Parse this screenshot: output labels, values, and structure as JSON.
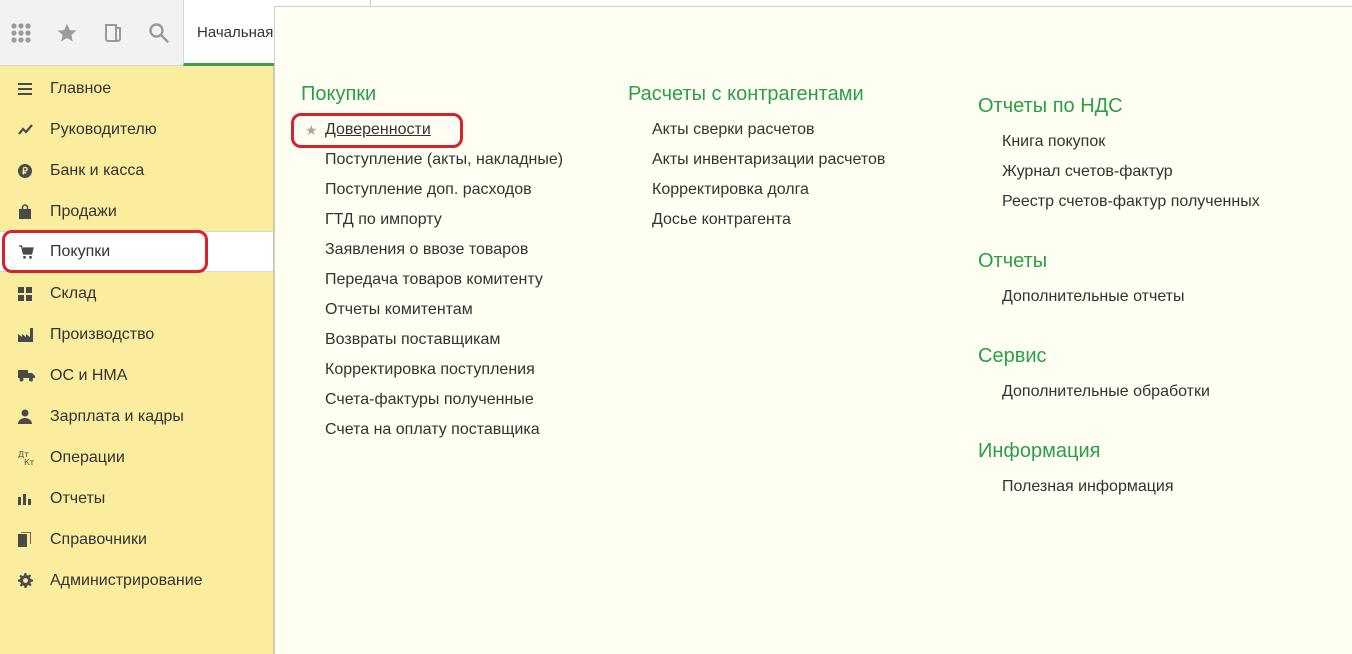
{
  "toolbar": {
    "icons": [
      "apps-grid-icon",
      "favorites-star-icon",
      "history-icon",
      "search-icon"
    ],
    "start_tab": "Начальная страница"
  },
  "sidebar": {
    "items": [
      {
        "label": "Главное",
        "icon": "menu-lines-icon"
      },
      {
        "label": "Руководителю",
        "icon": "trend-icon"
      },
      {
        "label": "Банк и касса",
        "icon": "ruble-coin-icon"
      },
      {
        "label": "Продажи",
        "icon": "shopping-bag-icon"
      },
      {
        "label": "Покупки",
        "icon": "shopping-cart-icon"
      },
      {
        "label": "Склад",
        "icon": "warehouse-grid-icon"
      },
      {
        "label": "Производство",
        "icon": "factory-icon"
      },
      {
        "label": "ОС и НМА",
        "icon": "truck-icon"
      },
      {
        "label": "Зарплата и кадры",
        "icon": "person-icon"
      },
      {
        "label": "Операции",
        "icon": "dt-kt-icon"
      },
      {
        "label": "Отчеты",
        "icon": "bar-chart-icon"
      },
      {
        "label": "Справочники",
        "icon": "books-icon"
      },
      {
        "label": "Администрирование",
        "icon": "gear-icon"
      }
    ],
    "active_index": 4
  },
  "panel": {
    "col1": {
      "title": "Покупки",
      "favorite_marker": "★",
      "links": [
        "Доверенности",
        "Поступление (акты, накладные)",
        "Поступление доп. расходов",
        "ГТД по импорту",
        "Заявления о ввозе товаров",
        "Передача товаров комитенту",
        "Отчеты комитентам",
        "Возвраты поставщикам",
        "Корректировка поступления",
        "Счета-фактуры полученные",
        "Счета на оплату поставщика"
      ]
    },
    "col2": {
      "title": "Расчеты с контрагентами",
      "links": [
        "Акты сверки расчетов",
        "Акты инвентаризации расчетов",
        "Корректировка долга",
        "Досье контрагента"
      ]
    },
    "col3": {
      "sections": [
        {
          "title": "Отчеты по НДС",
          "links": [
            "Книга покупок",
            "Журнал счетов-фактур",
            "Реестр счетов-фактур полученных"
          ]
        },
        {
          "title": "Отчеты",
          "links": [
            "Дополнительные отчеты"
          ]
        },
        {
          "title": "Сервис",
          "links": [
            "Дополнительные обработки"
          ]
        },
        {
          "title": "Информация",
          "links": [
            "Полезная информация"
          ]
        }
      ]
    }
  },
  "colors": {
    "sidebar_bg": "#fbed9e",
    "section_title": "#2a9f48",
    "highlight": "#d8222b",
    "active_tab_underline": "#3aa050"
  }
}
